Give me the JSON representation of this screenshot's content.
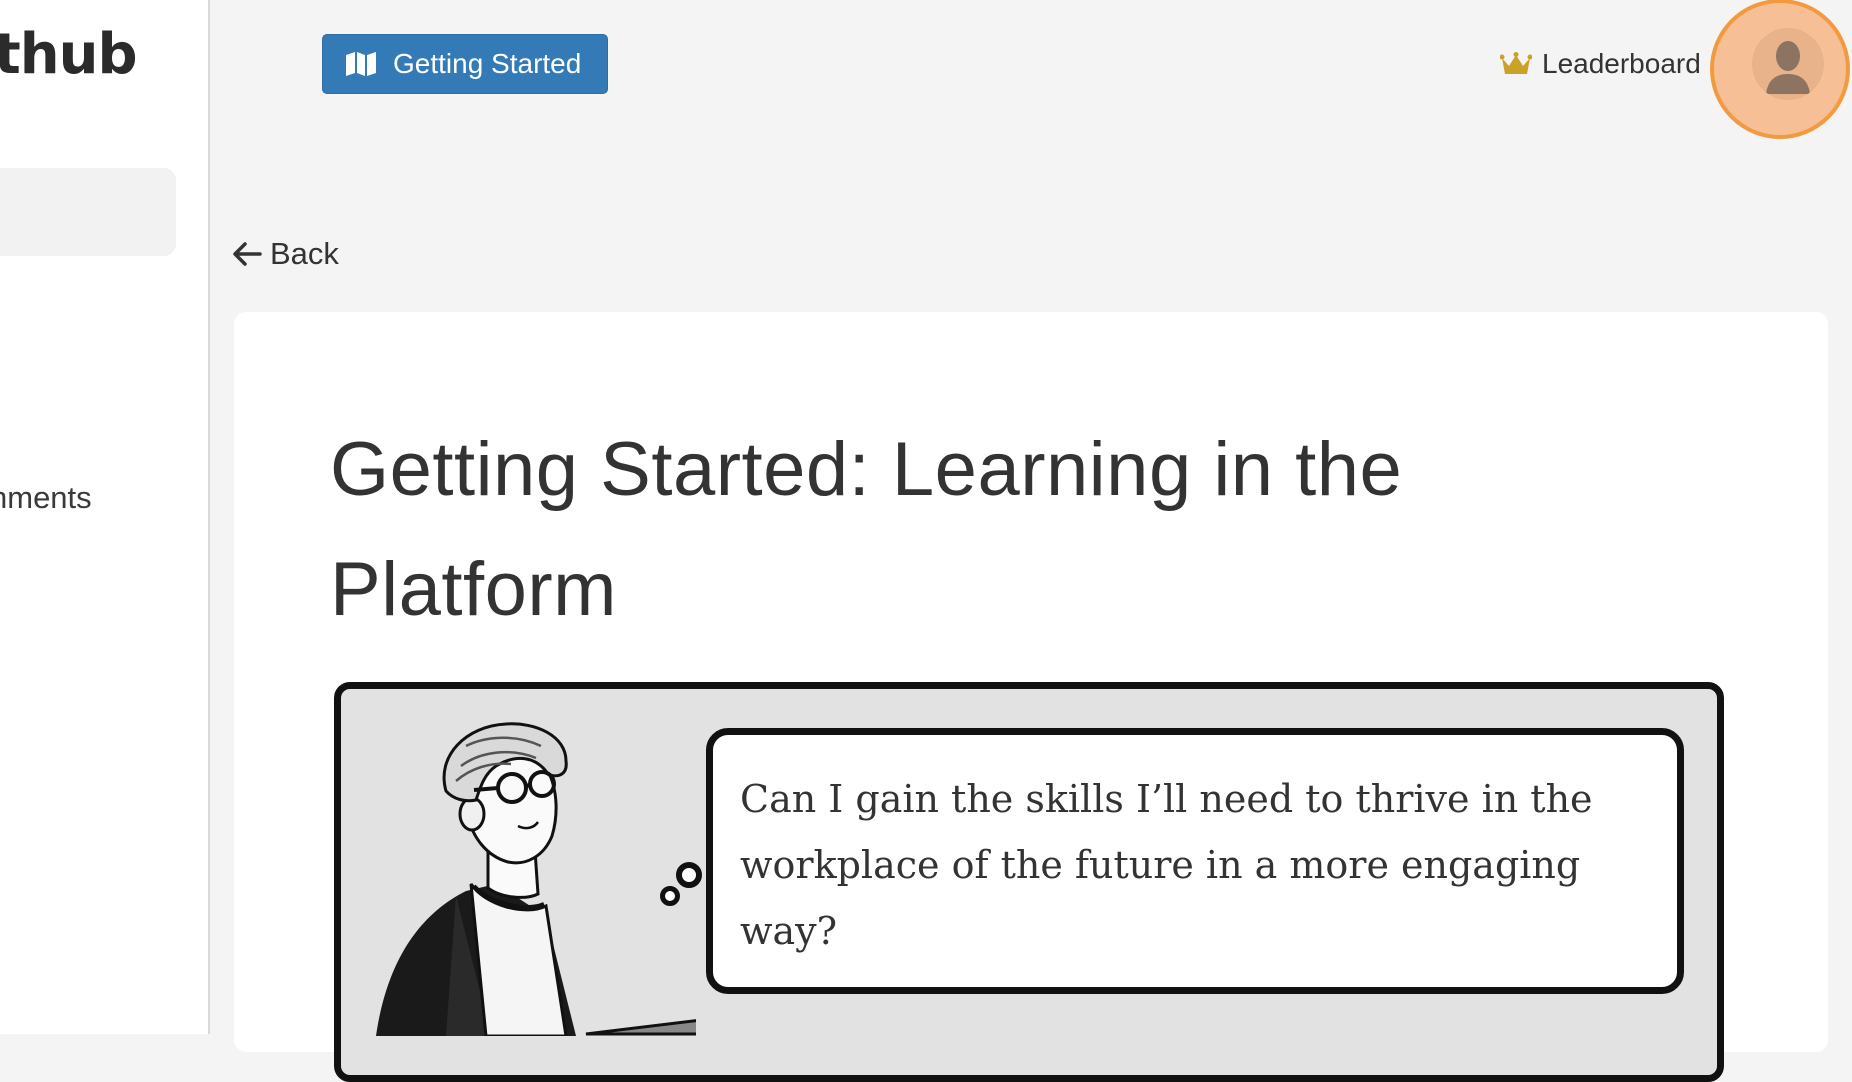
{
  "sidebar": {
    "brand_partial": "thub",
    "item_partial": "hments"
  },
  "topbar": {
    "getting_started_label": "Getting Started",
    "getting_started_icon": "map-icon",
    "leaderboard_label": "Leaderboard",
    "leaderboard_icon": "crown-icon",
    "avatar_icon": "user-avatar-icon"
  },
  "nav": {
    "back_label": "Back",
    "back_icon": "arrow-left-icon"
  },
  "article": {
    "title": "Getting Started: Learning in the Platform",
    "comic_bubble_text": "Can I gain the skills I’ll need to thrive in the workplace of the future in a more engaging way?"
  },
  "colors": {
    "primary_button": "#337ab7",
    "avatar_ring": "#f29a3f",
    "crown": "#c9a227"
  }
}
